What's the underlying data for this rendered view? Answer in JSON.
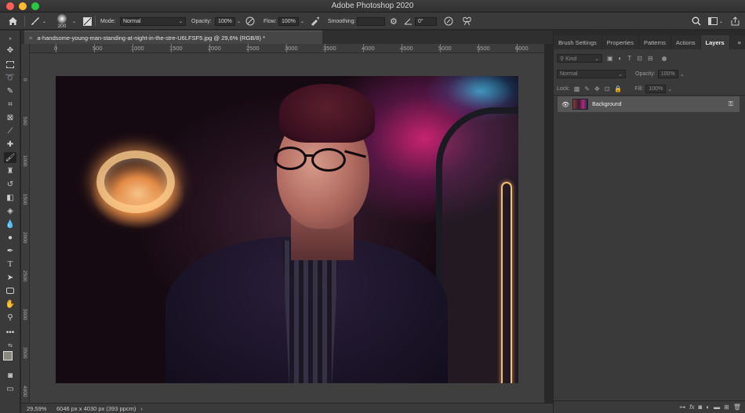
{
  "window": {
    "title": "Adobe Photoshop 2020"
  },
  "traffic_lights": {
    "close": "#ff5f57",
    "minimize": "#febc2e",
    "zoom": "#28c840"
  },
  "options_bar": {
    "brush_size": "200",
    "mode_label": "Mode:",
    "mode_value": "Normal",
    "opacity_label": "Opacity:",
    "opacity_value": "100%",
    "flow_label": "Flow:",
    "flow_value": "100%",
    "smoothing_label": "Smoothing:",
    "smoothing_value": "",
    "angle_value": "0°"
  },
  "document_tab": {
    "close_glyph": "×",
    "title": "a-handsome-young-man-standing-at-night-in-the-stre-U6LFSF5.jpg @ 29,6% (RGB/8) *"
  },
  "ruler_top": [
    "0",
    "500",
    "1000",
    "1500",
    "2000",
    "2500",
    "3000",
    "3500",
    "4000",
    "4500",
    "5000",
    "5500",
    "6000"
  ],
  "ruler_left": [
    "0",
    "500",
    "1000",
    "1500",
    "2000",
    "2500",
    "3000",
    "3500",
    "4000"
  ],
  "status_bar": {
    "zoom": "29,59%",
    "doc_info": "6046 px x 4030 px (393 ppcm)",
    "arrow": "›"
  },
  "panel": {
    "tabs": [
      "Brush Settings",
      "Properties",
      "Patterns",
      "Actions",
      "Layers"
    ],
    "active_tab": "Layers",
    "kind_filter": "Kind",
    "blend_mode": "Normal",
    "opacity_label": "Opacity:",
    "opacity_value": "100%",
    "lock_label": "Lock:",
    "fill_label": "Fill:",
    "fill_value": "100%",
    "layer_name": "Background"
  },
  "icons": {
    "home": "home-icon",
    "brush": "brush-icon",
    "lock": "lock-icon",
    "eye": "eye-icon"
  }
}
